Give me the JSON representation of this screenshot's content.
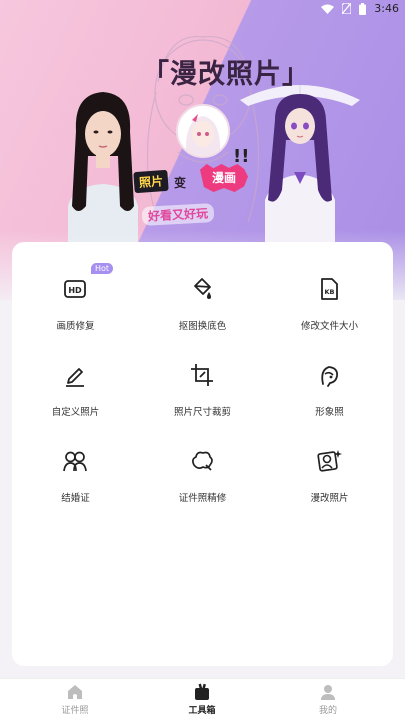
{
  "status_bar": {
    "time": "3:46"
  },
  "banner": {
    "title": "「漫改照片」",
    "tag_photo": "照片",
    "tag_change": "变",
    "tag_comic": "漫画",
    "tag_bang": "!!",
    "tag_fun": "好看又好玩"
  },
  "tools": [
    {
      "label": "画质修复",
      "icon": "hd-icon",
      "badge": "Hot"
    },
    {
      "label": "抠图换底色",
      "icon": "paint-bucket-icon"
    },
    {
      "label": "修改文件大小",
      "icon": "kb-file-icon"
    },
    {
      "label": "自定义照片",
      "icon": "pencil-icon"
    },
    {
      "label": "照片尺寸裁剪",
      "icon": "crop-icon"
    },
    {
      "label": "形象照",
      "icon": "portrait-icon"
    },
    {
      "label": "结婚证",
      "icon": "couple-icon"
    },
    {
      "label": "证件照精修",
      "icon": "retouch-icon"
    },
    {
      "label": "漫改照片",
      "icon": "comic-photo-icon"
    }
  ],
  "tabbar": {
    "tabs": [
      {
        "label": "证件照",
        "icon": "home-icon",
        "active": false
      },
      {
        "label": "工具箱",
        "icon": "toolbox-icon",
        "active": true
      },
      {
        "label": "我的",
        "icon": "user-icon",
        "active": false
      }
    ]
  },
  "colors": {
    "accent": "#a58ff0",
    "banner_pink": "#f3b9d4",
    "banner_purple": "#a98ee6"
  }
}
